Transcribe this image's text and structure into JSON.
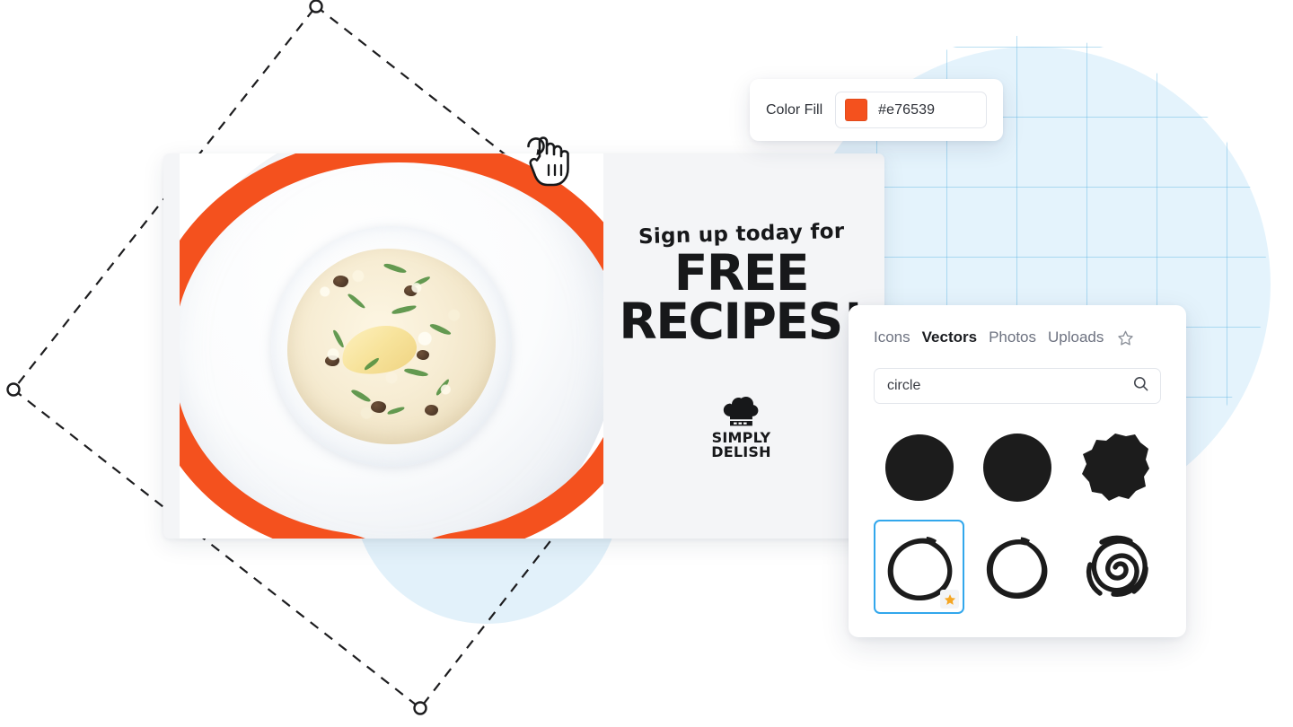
{
  "color_fill": {
    "label": "Color Fill",
    "hex_value": "#e76539",
    "swatch_color": "#f4511e"
  },
  "design_card": {
    "headline_small": "Sign up today for",
    "headline_line1": "FREE",
    "headline_line2": "RECIPES!",
    "brand_line1": "SIMPLY",
    "brand_line2": "DELISH",
    "brand_icon": "chef-hat-icon",
    "photo_alt": "mushroom-risotto-plate-photo",
    "accent_color": "#f4511e"
  },
  "assets_panel": {
    "tabs": [
      {
        "label": "Icons",
        "active": false
      },
      {
        "label": "Vectors",
        "active": true
      },
      {
        "label": "Photos",
        "active": false
      },
      {
        "label": "Uploads",
        "active": false
      }
    ],
    "favorites_icon": "star-outline-icon",
    "search": {
      "value": "circle",
      "placeholder": "Search",
      "icon": "search-icon"
    },
    "results": [
      {
        "name": "filled-blob-circle-1",
        "style": "filled",
        "selected": false,
        "favorite": false
      },
      {
        "name": "filled-circle-2",
        "style": "filled",
        "selected": false,
        "favorite": false
      },
      {
        "name": "filled-rough-circle-3",
        "style": "filled",
        "selected": false,
        "favorite": false
      },
      {
        "name": "brush-outline-circle-4",
        "style": "outline",
        "selected": true,
        "favorite": true
      },
      {
        "name": "thin-outline-circle-5",
        "style": "outline",
        "selected": false,
        "favorite": false
      },
      {
        "name": "scribble-spiral-circle-6",
        "style": "outline",
        "selected": false,
        "favorite": false
      }
    ],
    "selection_color": "#32a7ec",
    "favorite_color": "#f5a623"
  },
  "canvas": {
    "selection_handles": 4,
    "cursor": "rotate-hand-cursor",
    "selection_stroke_color": "#1d1d1f"
  }
}
